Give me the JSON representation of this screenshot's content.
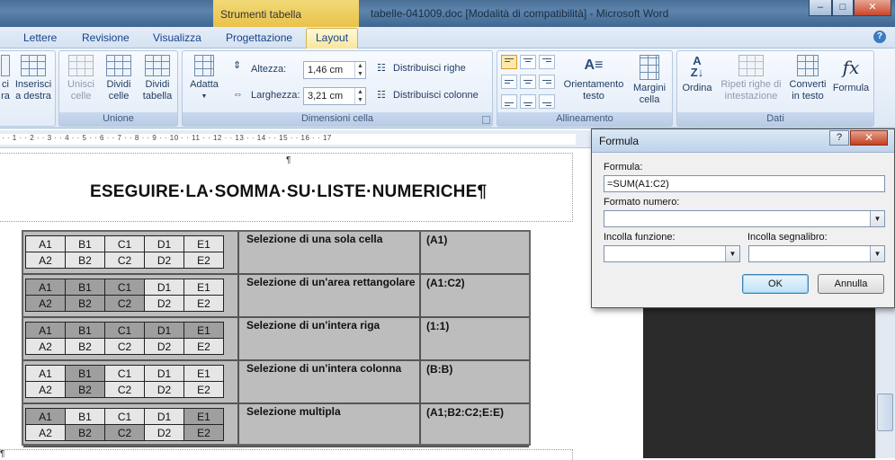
{
  "window": {
    "context_tab_header": "Strumenti tabella",
    "title": "tabelle-041009.doc [Modalità di compatibilità] - Microsoft Word",
    "minimize": "–",
    "maximize": "□",
    "close": "✕"
  },
  "tabs": [
    {
      "label": "Lettere"
    },
    {
      "label": "Revisione"
    },
    {
      "label": "Visualizza"
    },
    {
      "label": "Progettazione"
    },
    {
      "label": "Layout"
    }
  ],
  "help": "?",
  "ribbon": {
    "righe_colonne": {
      "insert_left_line1": "ci",
      "insert_left_line2": "ra",
      "insert_right_line1": "Inserisci",
      "insert_right_line2": "a destra"
    },
    "unione": {
      "label": "Unione",
      "merge_line1": "Unisci",
      "merge_line2": "celle",
      "split_cells_line1": "Dividi",
      "split_cells_line2": "celle",
      "split_table_line1": "Dividi",
      "split_table_line2": "tabella"
    },
    "dimensioni": {
      "label": "Dimensioni cella",
      "autofit": "Adatta",
      "height_label": "Altezza:",
      "height_value": "1,46 cm",
      "width_label": "Larghezza:",
      "width_value": "3,21 cm",
      "distribute_rows": "Distribuisci righe",
      "distribute_cols": "Distribuisci colonne"
    },
    "allineamento": {
      "label": "Allineamento",
      "text_direction_line1": "Orientamento",
      "text_direction_line2": "testo",
      "margins_line1": "Margini",
      "margins_line2": "cella"
    },
    "dati": {
      "label": "Dati",
      "sort": "Ordina",
      "repeat_line1": "Ripeti righe di",
      "repeat_line2": "intestazione",
      "convert_line1": "Converti",
      "convert_line2": "in testo",
      "formula": "Formula"
    }
  },
  "ruler": "· · 1 · · 2 · · 3 · · 4 · · 5 · · 6 · · 7 · · 8 · · 9 · · 10 · · 11 · · 12 · · 13 · · 14 · · 15 · · 16 · · 17",
  "document": {
    "heading": "ESEGUIRE·LA·SOMMA·SU·LISTE·NUMERICHE¶",
    "para_mark": "¶",
    "scan_rows": [
      {
        "desc": "Selezione di una sola cella",
        "ref": "(A1)",
        "r1": [
          "A1",
          "B1",
          "C1",
          "D1",
          "E1"
        ],
        "r2": [
          "A2",
          "B2",
          "C2",
          "D2",
          "E2"
        ]
      },
      {
        "desc": "Selezione di un'area rettangolare",
        "ref": "(A1:C2)",
        "r1": [
          "A1",
          "B1",
          "C1",
          "D1",
          "E1"
        ],
        "r2": [
          "A2",
          "B2",
          "C2",
          "D2",
          "E2"
        ]
      },
      {
        "desc": "Selezione di un'intera riga",
        "ref": "(1:1)",
        "r1": [
          "A1",
          "B1",
          "C1",
          "D1",
          "E1"
        ],
        "r2": [
          "A2",
          "B2",
          "C2",
          "D2",
          "E2"
        ]
      },
      {
        "desc": "Selezione di un'intera colonna",
        "ref": "(B:B)",
        "r1": [
          "A1",
          "B1",
          "C1",
          "D1",
          "E1"
        ],
        "r2": [
          "A2",
          "B2",
          "C2",
          "D2",
          "E2"
        ]
      },
      {
        "desc": "Selezione multipla",
        "ref": "(A1;B2:C2;E:E)",
        "r1": [
          "A1",
          "B1",
          "C1",
          "D1",
          "E1"
        ],
        "r2": [
          "A2",
          "B2",
          "C2",
          "D2",
          "E2"
        ]
      }
    ]
  },
  "dialog": {
    "title": "Formula",
    "help": "?",
    "close": "✕",
    "formula_label": "Formula:",
    "formula_value": "=SUM(A1:C2)",
    "number_format_label": "Formato numero:",
    "paste_function_label": "Incolla funzione:",
    "paste_bookmark_label": "Incolla segnalibro:",
    "ok": "OK",
    "cancel": "Annulla"
  }
}
